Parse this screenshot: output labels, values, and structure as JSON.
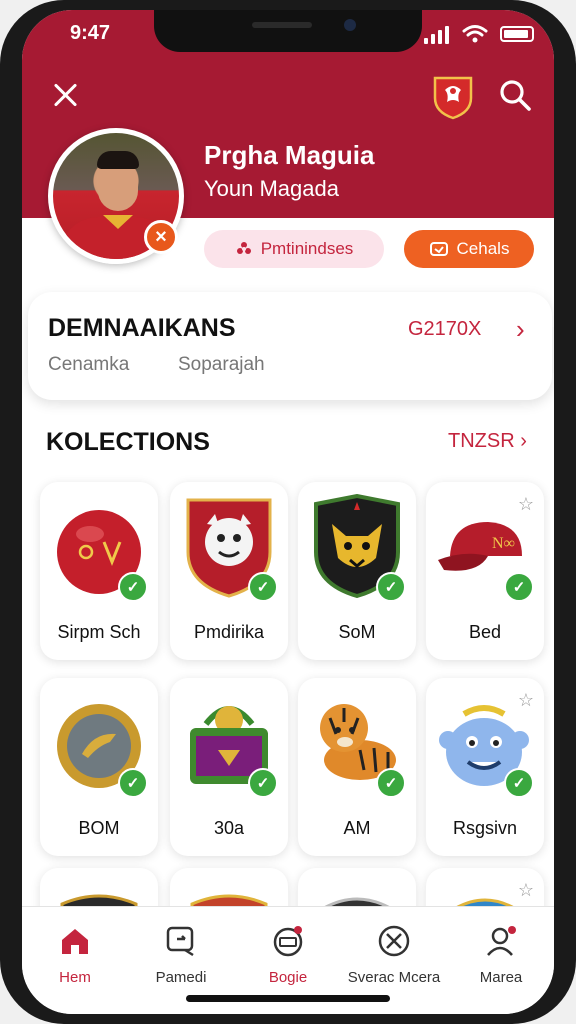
{
  "status_bar": {
    "time": "9:47"
  },
  "colors": {
    "brand": "#a61a33",
    "accent_orange": "#ee6122",
    "success": "#3aa83f",
    "pill_pink": "#fbe3ea"
  },
  "header": {
    "close_icon": "close-icon",
    "crest_icon": "club-crest-icon",
    "search_icon": "search-icon"
  },
  "profile": {
    "name": "Prgha Maguia",
    "subtitle": "Youn Magada",
    "pill_primary": "Pmtinindses",
    "pill_secondary": "Cehals"
  },
  "summary_card": {
    "title": "DEMNAAIKANS",
    "code": "G2170X",
    "chevron": "›",
    "sub_left": "Cenamka",
    "sub_right": "Soparajah"
  },
  "collections": {
    "title": "KOLECTIONS",
    "link": "TNZSR",
    "items": [
      {
        "label": "Sirpm Sch",
        "icon": "cap-ball-icon",
        "star": false
      },
      {
        "label": "Pmdirika",
        "icon": "mascot-shield-icon",
        "star": false
      },
      {
        "label": "SoM",
        "icon": "panther-badge-icon",
        "star": false
      },
      {
        "label": "Bed",
        "icon": "red-cap-icon",
        "star": true
      },
      {
        "label": "BOM",
        "icon": "gold-medal-icon",
        "star": false
      },
      {
        "label": "30a",
        "icon": "gift-basket-icon",
        "star": false
      },
      {
        "label": "AM",
        "icon": "tiger-icon",
        "star": false
      },
      {
        "label": "Rsgsivn",
        "icon": "blue-creature-icon",
        "star": true
      }
    ]
  },
  "nav": {
    "items": [
      {
        "label": "Hem",
        "icon": "home-icon",
        "active": true
      },
      {
        "label": "Pamedi",
        "icon": "chat-search-icon",
        "active": false
      },
      {
        "label": "Bogie",
        "icon": "ticket-icon",
        "active": true
      },
      {
        "label": "Sverac Mcera",
        "icon": "cancel-circle-icon",
        "active": false
      },
      {
        "label": "Marea",
        "icon": "profile-icon",
        "active": false
      }
    ]
  }
}
